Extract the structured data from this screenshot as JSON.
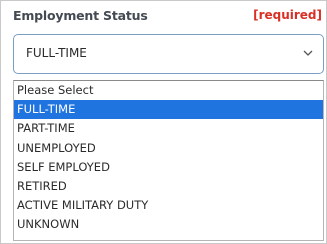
{
  "field": {
    "label": "Employment Status",
    "required_text": "[required]",
    "selected_value": "FULL-TIME",
    "chevron_icon": "chevron-down-icon"
  },
  "dropdown": {
    "options": [
      "Please Select",
      "FULL-TIME",
      "PART-TIME",
      "UNEMPLOYED",
      "SELF EMPLOYED",
      "RETIRED",
      "ACTIVE MILITARY DUTY",
      "UNKNOWN"
    ],
    "highlighted_index": 1
  },
  "colors": {
    "required": "#d93025",
    "selection": "#1f74e0",
    "select_border": "#7b9fc2"
  }
}
